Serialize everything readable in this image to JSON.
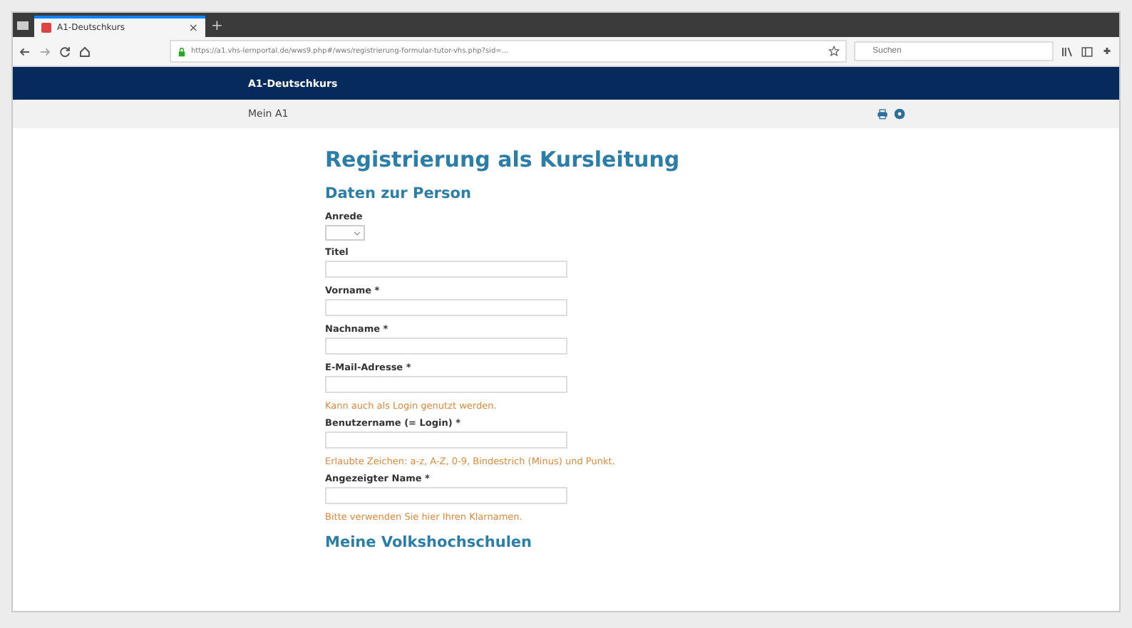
{
  "browser": {
    "tab": {
      "title": "A1-Deutschkurs",
      "close": "×"
    },
    "new_tab": "+",
    "url": "https://a1.vhs-lernportal.de/wws9.php#/wws/registrierung-formular-tutor-vhs.php?sid=...",
    "search": {
      "placeholder": "Suchen"
    }
  },
  "site": {
    "title": "A1-Deutschkurs",
    "nav": "Mein A1"
  },
  "page": {
    "title": "Registrierung als Kursleitung",
    "section": "Daten zur Person",
    "fields": [
      {
        "kind": "select",
        "label": "Anrede"
      },
      {
        "kind": "text",
        "label": "Titel"
      },
      {
        "kind": "text",
        "label": "Vorname *"
      },
      {
        "kind": "text",
        "label": "Nachname *"
      },
      {
        "kind": "text",
        "label": "E-Mail-Adresse *",
        "hint": "Kann auch als Login genutzt werden."
      },
      {
        "kind": "text",
        "label": "Benutzername (= Login) *",
        "hint": "Erlaubte Zeichen: a-z, A-Z, 0-9, Bindestrich (Minus) und Punkt."
      },
      {
        "kind": "text",
        "label": "Angezeigter Name *",
        "hint": "Bitte verwenden Sie hier Ihren Klarnamen."
      }
    ],
    "next_section": "Meine Volkshochschulen"
  }
}
